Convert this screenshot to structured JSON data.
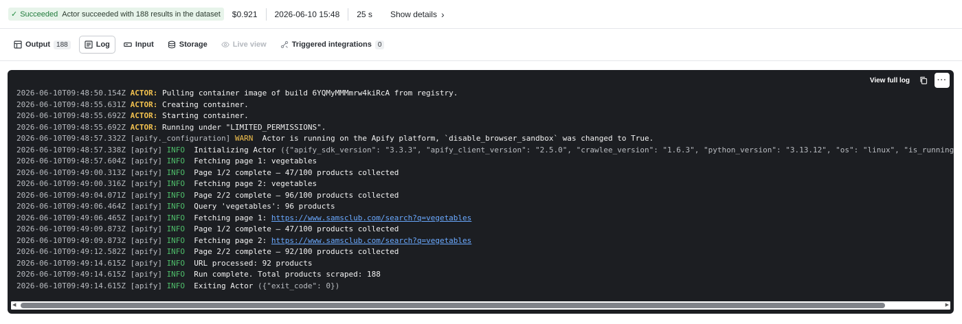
{
  "status": {
    "badge_label": "Succeeded",
    "badge_message": "Actor succeeded with 188 results in the dataset",
    "cost": "$0.921",
    "started_at": "2026-06-10 15:48",
    "duration": "25 s",
    "details_label": "Show details"
  },
  "tabs": [
    {
      "label": "Output",
      "count": "188",
      "icon": "table-icon",
      "active": false,
      "disabled": false
    },
    {
      "label": "Log",
      "icon": "log-icon",
      "active": true,
      "disabled": false
    },
    {
      "label": "Input",
      "icon": "input-icon",
      "active": false,
      "disabled": false
    },
    {
      "label": "Storage",
      "icon": "database-icon",
      "active": false,
      "disabled": false
    },
    {
      "label": "Live view",
      "icon": "eye-icon",
      "active": false,
      "disabled": true
    },
    {
      "label": "Triggered integrations",
      "count": "0",
      "icon": "integrations-icon",
      "active": false,
      "disabled": false
    }
  ],
  "log": {
    "view_full_label": "View full log",
    "more_label": "···",
    "lines": [
      {
        "ts": "2026-06-10T09:48:50.154Z",
        "src": "ACTOR:",
        "kind": "actor",
        "level": "",
        "msg": " Pulling container image of build 6YQMyMMMmrw4kiRcA from registry."
      },
      {
        "ts": "2026-06-10T09:48:55.631Z",
        "src": "ACTOR:",
        "kind": "actor",
        "level": "",
        "msg": " Creating container."
      },
      {
        "ts": "2026-06-10T09:48:55.692Z",
        "src": "ACTOR:",
        "kind": "actor",
        "level": "",
        "msg": " Starting container."
      },
      {
        "ts": "2026-06-10T09:48:55.692Z",
        "src": "ACTOR:",
        "kind": "actor",
        "level": "",
        "msg": " Running under \"LIMITED_PERMISSIONS\"."
      },
      {
        "ts": "2026-06-10T09:48:57.332Z",
        "src": "[apify._configuration]",
        "kind": "logger",
        "level": "WARN",
        "msg": "  Actor is running on the Apify platform, `disable_browser_sandbox` was changed to True."
      },
      {
        "ts": "2026-06-10T09:48:57.338Z",
        "src": "[apify]",
        "kind": "logger",
        "level": "INFO",
        "msg": "  Initializing Actor",
        "extra": " ({\"apify_sdk_version\": \"3.3.3\", \"apify_client_version\": \"2.5.0\", \"crawlee_version\": \"1.6.3\", \"python_version\": \"3.13.12\", \"os\": \"linux\", \"is_running_in_ipyt"
      },
      {
        "ts": "2026-06-10T09:48:57.604Z",
        "src": "[apify]",
        "kind": "logger",
        "level": "INFO",
        "msg": "  Fetching page 1: vegetables"
      },
      {
        "ts": "2026-06-10T09:49:00.313Z",
        "src": "[apify]",
        "kind": "logger",
        "level": "INFO",
        "msg": "  Page 1/2 complete — 47/100 products collected"
      },
      {
        "ts": "2026-06-10T09:49:00.316Z",
        "src": "[apify]",
        "kind": "logger",
        "level": "INFO",
        "msg": "  Fetching page 2: vegetables"
      },
      {
        "ts": "2026-06-10T09:49:04.071Z",
        "src": "[apify]",
        "kind": "logger",
        "level": "INFO",
        "msg": "  Page 2/2 complete — 96/100 products collected"
      },
      {
        "ts": "2026-06-10T09:49:06.464Z",
        "src": "[apify]",
        "kind": "logger",
        "level": "INFO",
        "msg": "  Query 'vegetables': 96 products"
      },
      {
        "ts": "2026-06-10T09:49:06.465Z",
        "src": "[apify]",
        "kind": "logger",
        "level": "INFO",
        "msg": "  Fetching page 1: ",
        "url": "https://www.samsclub.com/search?q=vegetables"
      },
      {
        "ts": "2026-06-10T09:49:09.873Z",
        "src": "[apify]",
        "kind": "logger",
        "level": "INFO",
        "msg": "  Page 1/2 complete — 47/100 products collected"
      },
      {
        "ts": "2026-06-10T09:49:09.873Z",
        "src": "[apify]",
        "kind": "logger",
        "level": "INFO",
        "msg": "  Fetching page 2: ",
        "url": "https://www.samsclub.com/search?q=vegetables"
      },
      {
        "ts": "2026-06-10T09:49:12.582Z",
        "src": "[apify]",
        "kind": "logger",
        "level": "INFO",
        "msg": "  Page 2/2 complete — 92/100 products collected"
      },
      {
        "ts": "2026-06-10T09:49:14.615Z",
        "src": "[apify]",
        "kind": "logger",
        "level": "INFO",
        "msg": "  URL processed: 92 products"
      },
      {
        "ts": "2026-06-10T09:49:14.615Z",
        "src": "[apify]",
        "kind": "logger",
        "level": "INFO",
        "msg": "  Run complete. Total products scraped: 188"
      },
      {
        "ts": "2026-06-10T09:49:14.615Z",
        "src": "[apify]",
        "kind": "logger",
        "level": "INFO",
        "msg": "  Exiting Actor",
        "extra": " ({\"exit_code\": 0})"
      }
    ]
  },
  "colors": {
    "success": "#1f8a3f",
    "log_background": "#1c1e22",
    "actor_label": "#f2c14e",
    "info_level": "#4fbf6b",
    "warn_level": "#f2c14e",
    "link": "#6aa9ff"
  }
}
